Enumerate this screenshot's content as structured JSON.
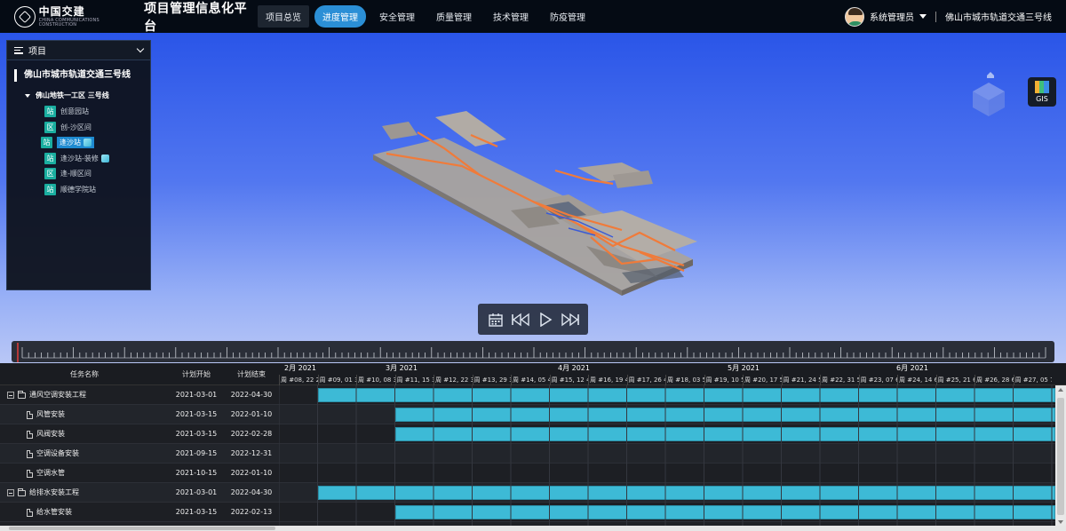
{
  "header": {
    "logo_cn": "中国交建",
    "logo_en": "CHINA COMMUNICATIONS CONSTRUCTION",
    "app_title": "项目管理信息化平台",
    "nav": [
      {
        "label": "项目总览",
        "state": "home"
      },
      {
        "label": "进度管理",
        "state": "active"
      },
      {
        "label": "安全管理",
        "state": "normal"
      },
      {
        "label": "质量管理",
        "state": "normal"
      },
      {
        "label": "技术管理",
        "state": "normal"
      },
      {
        "label": "防疫管理",
        "state": "normal"
      }
    ],
    "user_name": "系统管理员",
    "current_project": "佛山市城市轨道交通三号线"
  },
  "project_panel": {
    "title": "项目",
    "project_name": "佛山市城市轨道交通三号线",
    "section": "佛山地铁一工区  三号线",
    "items": [
      {
        "tag": "站",
        "label": "创意园站",
        "selected": false,
        "model": false
      },
      {
        "tag": "区",
        "label": "创-沙区间",
        "selected": false,
        "model": false
      },
      {
        "tag": "站",
        "label": "逢沙站",
        "selected": true,
        "model": true
      },
      {
        "tag": "站",
        "label": "逢沙站-装修",
        "selected": false,
        "model": true
      },
      {
        "tag": "区",
        "label": "逢-顺区间",
        "selected": false,
        "model": false
      },
      {
        "tag": "站",
        "label": "顺德学院站",
        "selected": false,
        "model": false
      }
    ]
  },
  "viewer": {
    "gis_label": "GIS",
    "colors": {
      "sky_top": "#2a55e8",
      "sky_bottom": "#b9c7f6",
      "structure": "#a59f9a",
      "highlight": "#f07b3a"
    }
  },
  "playback": {
    "buttons": [
      "calendar-icon",
      "skip-back-icon",
      "play-icon",
      "skip-forward-icon"
    ]
  },
  "gantt": {
    "columns": {
      "task": "任务名称",
      "start": "计划开始",
      "end": "计划结束"
    },
    "months": [
      "2月 2021",
      "3月 2021",
      "4月 2021",
      "5月 2021",
      "6月 2021"
    ],
    "weeks": [
      "周 #08, 22 2",
      "周 #09, 01 3",
      "周 #10, 08 3",
      "周 #11, 15 3",
      "周 #12, 22 3",
      "周 #13, 29 3",
      "周 #14, 05 4",
      "周 #15, 12 4",
      "周 #16, 19 4",
      "周 #17, 26 4",
      "周 #18, 03 5",
      "周 #19, 10 5",
      "周 #20, 17 5",
      "周 #21, 24 5",
      "周 #22, 31 5",
      "周 #23, 07 6",
      "周 #24, 14 6",
      "周 #25, 21 6",
      "周 #26, 28 6",
      "周 #27, 05 7"
    ],
    "rows": [
      {
        "name": "通风空调安装工程",
        "start": "2021-03-01",
        "end": "2022-04-30",
        "level": 0
      },
      {
        "name": "风管安装",
        "start": "2021-03-15",
        "end": "2022-01-10",
        "level": 1
      },
      {
        "name": "风阀安装",
        "start": "2021-03-15",
        "end": "2022-02-28",
        "level": 1
      },
      {
        "name": "空调设备安装",
        "start": "2021-09-15",
        "end": "2022-12-31",
        "level": 1
      },
      {
        "name": "空调水管",
        "start": "2021-10-15",
        "end": "2022-01-10",
        "level": 1
      },
      {
        "name": "给排水安装工程",
        "start": "2021-03-01",
        "end": "2022-04-30",
        "level": 0
      },
      {
        "name": "给水管安装",
        "start": "2021-03-15",
        "end": "2022-02-13",
        "level": 1
      }
    ],
    "timeline_start": "2021-02-22",
    "days_per_week": 7,
    "bar_color": "#3dbad6"
  }
}
